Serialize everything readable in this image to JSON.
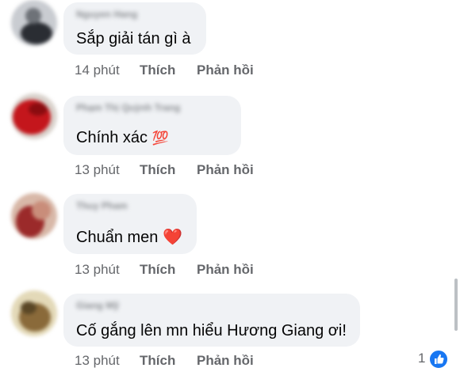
{
  "comments": [
    {
      "author": "Nguyen Hang",
      "text": "Sắp giải tán gì à",
      "time": "14 phút",
      "like": "Thích",
      "reply": "Phản hồi"
    },
    {
      "author": "Phạm Thị Quỳnh Trang",
      "text": "Chính xác",
      "emoji": "💯",
      "time": "13 phút",
      "like": "Thích",
      "reply": "Phản hồi"
    },
    {
      "author": "Thuy Pham",
      "text": "Chuẩn men",
      "emoji": "❤️",
      "time": "13 phút",
      "like": "Thích",
      "reply": "Phản hồi"
    },
    {
      "author": "Giang Mỹ",
      "text": "Cố gắng lên mn hiểu Hương Giang ơi!",
      "time": "13 phút",
      "like": "Thích",
      "reply": "Phản hồi",
      "reaction_count": "1",
      "reaction_icon": "thumbs-up-icon"
    }
  ],
  "colors": {
    "bubble": "#f0f2f5",
    "meta": "#65676b",
    "like_blue": "#1877f2"
  }
}
